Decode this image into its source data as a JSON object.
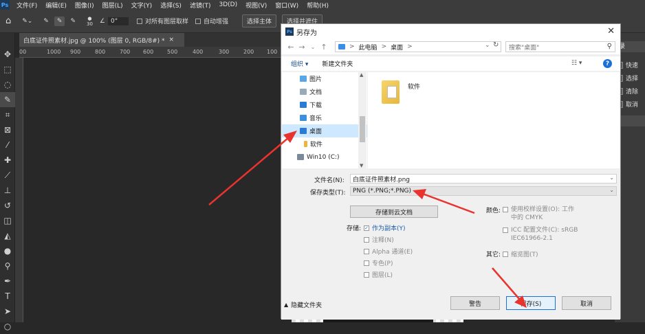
{
  "menubar": {
    "items": [
      "文件(F)",
      "编辑(E)",
      "图像(I)",
      "图层(L)",
      "文字(Y)",
      "选择(S)",
      "滤镜(T)",
      "3D(D)",
      "视图(V)",
      "窗口(W)",
      "帮助(H)"
    ]
  },
  "options": {
    "brush_size": "30",
    "angle": "0°",
    "sample_all": "对所有图层取样",
    "auto_enhance": "自动增强",
    "select_subject": "选择主体",
    "select_and_mask": "选择并遮住"
  },
  "document": {
    "tab": "白底证件照素材.jpg @ 100% (图层 0, RGB/8#) *",
    "ruler_ticks": [
      "00",
      "1000",
      "900",
      "800",
      "700",
      "600",
      "500",
      "400",
      "300",
      "200",
      "100"
    ]
  },
  "right_panel": {
    "tab": "录",
    "items": [
      "快速",
      "选择",
      "清除",
      "取消"
    ]
  },
  "dialog": {
    "title": "另存为",
    "address": {
      "segments": [
        "此电脑",
        "桌面"
      ],
      "separator": ">"
    },
    "search_placeholder": "搜索\"桌面\"",
    "toolbar": {
      "organize": "组织 ▾",
      "new_folder": "新建文件夹"
    },
    "nav_items": [
      {
        "label": "图片"
      },
      {
        "label": "文档"
      },
      {
        "label": "下载"
      },
      {
        "label": "音乐"
      },
      {
        "label": "桌面",
        "selected": true
      },
      {
        "label": "软件"
      },
      {
        "label": "Win10 (C:)"
      }
    ],
    "files": [
      {
        "name": "软件"
      }
    ],
    "filename_label": "文件名(N):",
    "filename_value": "白底证件照素材.png",
    "filetype_label": "保存类型(T):",
    "filetype_value": "PNG (*.PNG;*.PNG)",
    "cloud_button": "存储到云文档",
    "save_label": "存储:",
    "save_options": [
      {
        "label": "作为副本(Y)",
        "checked": true
      },
      {
        "label": "注释(N)",
        "checked": false
      },
      {
        "label": "Alpha 通道(E)",
        "checked": false
      },
      {
        "label": "专色(P)",
        "checked": false
      },
      {
        "label": "图层(L)",
        "checked": false
      }
    ],
    "color_label": "颜色:",
    "color_options": [
      "使用校样设置(O): 工作中的 CMYK",
      "ICC 配置文件(C): sRGB IEC61966-2.1"
    ],
    "other_label": "其它:",
    "thumbnail": "缩览图(T)",
    "hide_folders": "隐藏文件夹",
    "warning_button": "警告",
    "save_button": "保存(S)",
    "cancel_button": "取消"
  },
  "colors": {
    "ps_bg": "#282828",
    "dialog_bg": "#f0f0f0",
    "accent": "#1a6fd8",
    "annotation": "#e8332e"
  }
}
